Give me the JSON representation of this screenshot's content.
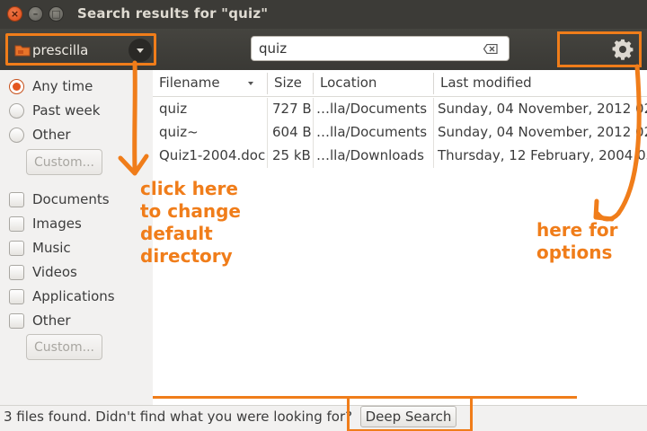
{
  "window": {
    "title": "Search results for \"quiz\"",
    "controls": [
      "close",
      "minimize",
      "maximize"
    ]
  },
  "toolbar": {
    "directory_label": "prescilla",
    "search_value": "quiz",
    "icons": [
      "folder-icon",
      "dropdown-icon",
      "clear-search-icon",
      "gear-icon"
    ]
  },
  "sidebar": {
    "time_filters": [
      {
        "label": "Any time",
        "selected": true
      },
      {
        "label": "Past week",
        "selected": false
      },
      {
        "label": "Other",
        "selected": false
      }
    ],
    "time_custom_label": "Custom...",
    "type_filters": [
      {
        "label": "Documents",
        "checked": false
      },
      {
        "label": "Images",
        "checked": false
      },
      {
        "label": "Music",
        "checked": false
      },
      {
        "label": "Videos",
        "checked": false
      },
      {
        "label": "Applications",
        "checked": false
      },
      {
        "label": "Other",
        "checked": false
      }
    ],
    "type_custom_label": "Custom..."
  },
  "table": {
    "columns": [
      "Filename",
      "Size",
      "Location",
      "Last modified"
    ],
    "rows": [
      [
        "quiz",
        "727 B",
        "…lla/Documents",
        "Sunday, 04 November, 2012 02:"
      ],
      [
        "quiz~",
        "604 B",
        "…lla/Documents",
        "Sunday, 04 November, 2012 02:"
      ],
      [
        "Quiz1-2004.doc",
        "25 kB",
        "…lla/Downloads",
        "Thursday, 12 February, 2004 03"
      ]
    ]
  },
  "status": {
    "text": "3 files found.  Didn't find what you were looking for?",
    "deep_search_label": "Deep Search"
  },
  "annotations": {
    "directory_note": "click here\nto change\ndefault\ndirectory",
    "options_note": "here for\noptions"
  },
  "colors": {
    "annotation": "#f07d1a",
    "titlebar": "#3c3b37",
    "sidebar": "#f2f1f0",
    "close_button": "#df4a16"
  }
}
